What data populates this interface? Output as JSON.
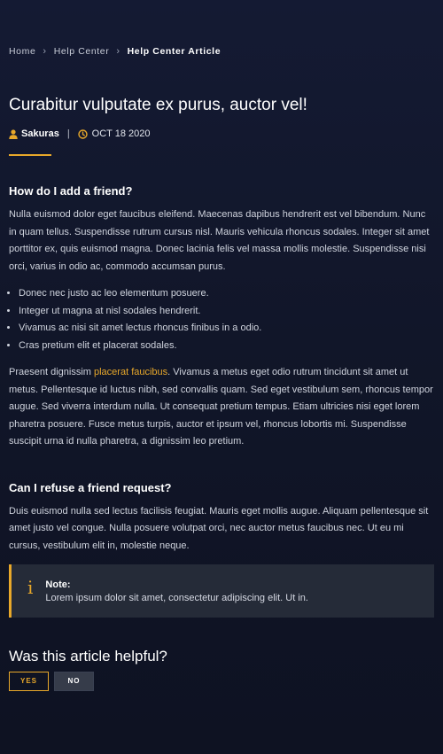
{
  "breadcrumb": {
    "items": [
      "Home",
      "Help Center"
    ],
    "current": "Help Center Article"
  },
  "article": {
    "title": "Curabitur vulputate ex purus, auctor vel!",
    "author": "Sakuras",
    "date": "OCT 18 2020",
    "sections": [
      {
        "heading": "How do I add a friend?",
        "paragraph": "Nulla euismod dolor eget faucibus eleifend. Maecenas dapibus hendrerit est vel bibendum. Nunc in quam tellus. Suspendisse rutrum cursus nisl. Mauris vehicula rhoncus sodales. Integer sit amet porttitor ex, quis euismod magna. Donec lacinia felis vel massa mollis molestie. Suspendisse nisi orci, varius in odio ac, commodo accumsan purus.",
        "bullets": [
          "Donec nec justo ac leo elementum posuere.",
          "Integer ut magna at nisl sodales hendrerit.",
          "Vivamus ac nisi sit amet lectus rhoncus finibus in a odio.",
          "Cras pretium elit et placerat sodales."
        ],
        "p2_before": "Praesent dignissim ",
        "p2_link": "placerat faucibus",
        "p2_after": ". Vivamus a metus eget odio rutrum tincidunt sit amet ut metus. Pellentesque id luctus nibh, sed convallis quam. Sed eget vestibulum sem, rhoncus tempor augue. Sed viverra interdum nulla. Ut consequat pretium tempus. Etiam ultricies nisi eget lorem pharetra posuere. Fusce metus turpis, auctor et ipsum vel, rhoncus lobortis mi. Suspendisse suscipit urna id nulla pharetra, a dignissim leo pretium."
      },
      {
        "heading": "Can I refuse a friend request?",
        "paragraph": "Duis euismod nulla sed lectus facilisis feugiat. Mauris eget mollis augue. Aliquam pellentesque sit amet justo vel congue. Nulla posuere volutpat orci, nec auctor metus faucibus nec. Ut eu mi cursus, vestibulum elit in, molestie neque."
      }
    ],
    "note": {
      "icon": "info-icon",
      "label": "Note:",
      "text": "Lorem ipsum dolor sit amet, consectetur adipiscing elit. Ut in."
    }
  },
  "helpful": {
    "title": "Was this article helpful?",
    "yes_label": "YES",
    "no_label": "NO"
  },
  "colors": {
    "accent": "#e8a82a",
    "background": "#111629",
    "note_bg": "#252b38"
  }
}
